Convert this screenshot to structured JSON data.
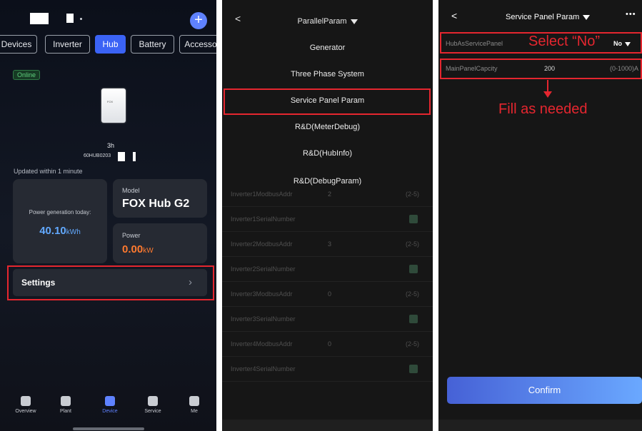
{
  "device_screen": {
    "tabs": [
      "Devices",
      "Inverter",
      "Hub",
      "Battery",
      "Accesso"
    ],
    "active_tab": "Hub",
    "status": "Online",
    "device_logo": "FOX",
    "time_label": "3h",
    "serial": "60HUB0203",
    "updated": "Updated  within 1 minute",
    "gen_label": "Power generation today:",
    "gen_value": "40.10",
    "gen_unit": "kWh",
    "model_label": "Model",
    "model_value": "FOX Hub G2",
    "power_label": "Power",
    "power_value": "0.00",
    "power_unit": "kW",
    "settings_label": "Settings",
    "nav": [
      {
        "label": "Overview",
        "icon": "overview-icon"
      },
      {
        "label": "Plant",
        "icon": "plant-icon"
      },
      {
        "label": "Device",
        "icon": "device-icon"
      },
      {
        "label": "Service",
        "icon": "service-icon"
      },
      {
        "label": "Me",
        "icon": "me-icon"
      }
    ],
    "accent": "#3b63f5",
    "gen_color": "#62a9ff",
    "power_color": "#ff7a2f"
  },
  "param_screen": {
    "back": "<",
    "title": "ParallelParam",
    "menu": [
      "Generator",
      "Three Phase System",
      "Service Panel Param",
      "R&D(MeterDebug)",
      "R&D(HubInfo)",
      "R&D(DebugParam)"
    ],
    "rows": [
      {
        "key": "Inverter1ModbusAddr",
        "value": "2",
        "range": "(2-5)"
      },
      {
        "key": "Inverter1SerialNumber",
        "value": "",
        "range": ""
      },
      {
        "key": "Inverter2ModbusAddr",
        "value": "3",
        "range": "(2-5)"
      },
      {
        "key": "Inverter2SerialNumber",
        "value": "",
        "range": ""
      },
      {
        "key": "Inverter3ModbusAddr",
        "value": "0",
        "range": "(2-5)"
      },
      {
        "key": "Inverter3SerialNumber",
        "value": "",
        "range": ""
      },
      {
        "key": "Inverter4ModbusAddr",
        "value": "0",
        "range": "(2-5)"
      },
      {
        "key": "Inverter4SerialNumber",
        "value": "",
        "range": ""
      }
    ]
  },
  "service_screen": {
    "back": "<",
    "title": "Service Panel Param",
    "more": "•••",
    "hub_key": "HubAsServicePanel",
    "hub_value": "No",
    "annot_select": "Select “No”",
    "main_key": "MainPanelCapcity",
    "main_value": "200",
    "main_range": "(0-1000)A",
    "annot_fill": "Fill as needed",
    "confirm": "Confirm",
    "highlight_color": "#e5262f"
  }
}
